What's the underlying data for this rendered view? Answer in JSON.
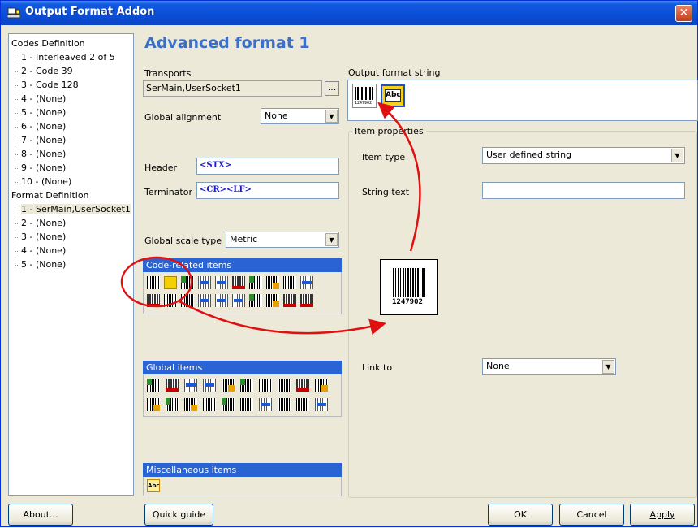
{
  "window": {
    "title": "Output Format Addon"
  },
  "tree": {
    "codes_root": "Codes Definition",
    "codes": [
      "1 - Interleaved 2 of 5",
      "2 - Code 39",
      "3 - Code 128",
      "4 - (None)",
      "5 - (None)",
      "6 - (None)",
      "7 - (None)",
      "8 - (None)",
      "9 - (None)",
      "10 - (None)"
    ],
    "format_root": "Format Definition",
    "formats": [
      "1 - SerMain,UserSocket1",
      "2 - (None)",
      "3 - (None)",
      "4 - (None)",
      "5 - (None)"
    ]
  },
  "main": {
    "heading": "Advanced format 1",
    "transports_label": "Transports",
    "transports_value": "SerMain,UserSocket1",
    "transports_button": "...",
    "global_alignment_label": "Global alignment",
    "global_alignment_value": "None",
    "header_label": "Header",
    "header_value": "<STX>",
    "terminator_label": "Terminator",
    "terminator_value": "<CR><LF>",
    "global_scale_label": "Global scale type",
    "global_scale_value": "Metric"
  },
  "panels": {
    "code_related": "Code-related items",
    "global": "Global items",
    "misc": "Miscellaneous items",
    "misc_abc": "Abc"
  },
  "output": {
    "label": "Output format string",
    "barcode_number": "1247902",
    "abc": "Abc"
  },
  "item_props": {
    "legend": "Item properties",
    "item_type_label": "Item type",
    "item_type_value": "User defined string",
    "string_text_label": "String text",
    "string_text_value": "",
    "link_to_label": "Link to",
    "link_to_value": "None",
    "preview_number": "1247902"
  },
  "buttons": {
    "about": "About...",
    "quick_guide": "Quick guide",
    "ok": "OK",
    "cancel": "Cancel",
    "apply": "Apply"
  },
  "colors": {
    "titlebar": "#0a4ed6",
    "panel_header": "#2a63d4",
    "heading": "#3b6fc8",
    "annotation": "#e01010"
  }
}
